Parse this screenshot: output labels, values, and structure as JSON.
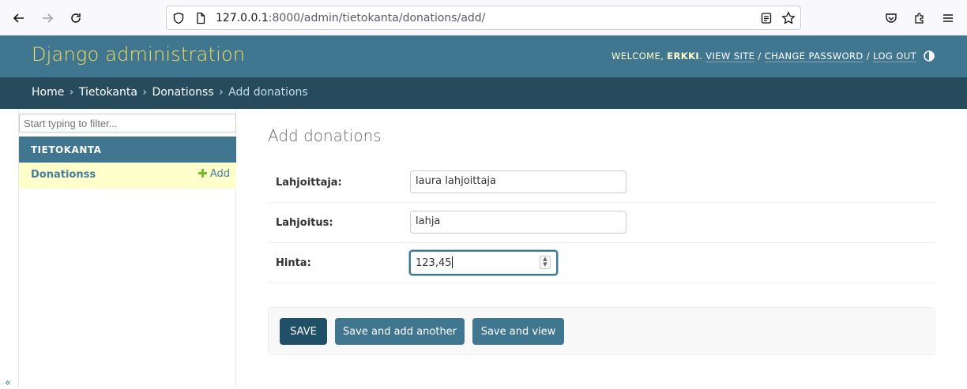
{
  "browser": {
    "url_host": "127.0.0.1",
    "url_rest": ":8000/admin/tietokanta/donations/add/"
  },
  "header": {
    "brand": "Django administration",
    "welcome": "WELCOME,",
    "username": "ERKKI",
    "view_site": "VIEW SITE",
    "change_password": "CHANGE PASSWORD",
    "log_out": "LOG OUT",
    "separator": "/"
  },
  "breadcrumbs": {
    "home": "Home",
    "app": "Tietokanta",
    "model": "Donationss",
    "current": "Add donations",
    "separator": "›"
  },
  "sidebar": {
    "filter_placeholder": "Start typing to filter...",
    "app_name": "TIETOKANTA",
    "model_name": "Donationss",
    "add_label": "Add",
    "collapse_glyph": "«"
  },
  "content": {
    "title": "Add donations",
    "fields": [
      {
        "label": "Lahjoittaja:",
        "value": "laura lahjoittaja"
      },
      {
        "label": "Lahjoitus:",
        "value": "lahja"
      },
      {
        "label": "Hinta:",
        "value": "123,45"
      }
    ]
  },
  "submit": {
    "save": "SAVE",
    "save_add_another": "Save and add another",
    "save_view": "Save and view"
  },
  "colors": {
    "header_bg": "#417690",
    "breadcrumb_bg": "#264b5d",
    "brand": "#f5dd5d",
    "selected_row": "#ffffcc",
    "button_default": "#205067"
  }
}
